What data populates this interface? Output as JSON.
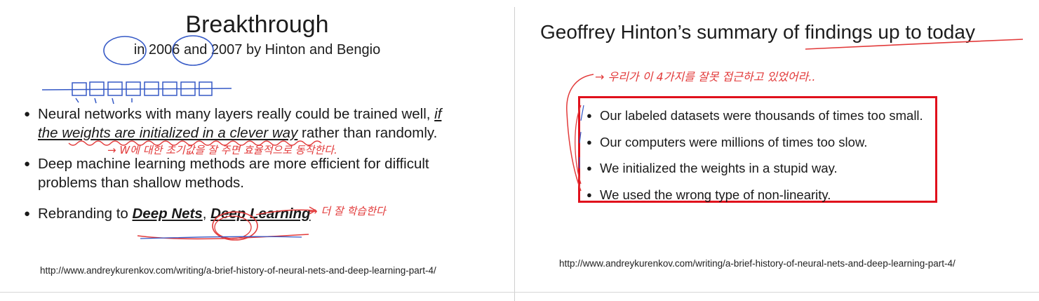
{
  "left_slide": {
    "title": "Breakthrough",
    "subtitle": {
      "prefix": "in",
      "year1": "2006",
      "middle": "and",
      "year2": "2007",
      "suffix": "by Hinton and Bengio"
    },
    "bullets": {
      "b1": {
        "line1": "Neural networks with many layers really could be trained",
        "prefix": "well,",
        "emphasis": "if the weights are initialized in a clever way",
        "suffix": "rather than randomly."
      },
      "b2": "Deep machine learning methods are more efficient for difficult problems than shallow methods.",
      "b3": {
        "prefix": "Rebranding to",
        "term1": "Deep Nets",
        "sep": ",",
        "term2": "Deep Learning"
      }
    },
    "url": "http://www.andreykurenkov.com/writing/a-brief-history-of-neural-nets-and-deep-learning-part-4/",
    "notes": {
      "note1": "→ W에 대한 초기값을 잘 주면 효율적으로 동작한다.",
      "note2": "→ 더 잘 학습한다"
    }
  },
  "right_slide": {
    "title": "Geoffrey Hinton’s summary of findings up to today",
    "bullets": [
      "Our labeled datasets were thousands of times too small.",
      "Our computers were millions of times too slow.",
      "We initialized the weights in a stupid way.",
      "We used the wrong type of non-linearity."
    ],
    "url": "http://www.andreykurenkov.com/writing/a-brief-history-of-neural-nets-and-deep-learning-part-4/",
    "note": "→ 우리가 이 4가지를 잘못 접근하고 있었어라.."
  },
  "colors": {
    "ink_red": "#e23a3a",
    "ink_blue": "#3559c6",
    "box_red": "#e0101c"
  }
}
